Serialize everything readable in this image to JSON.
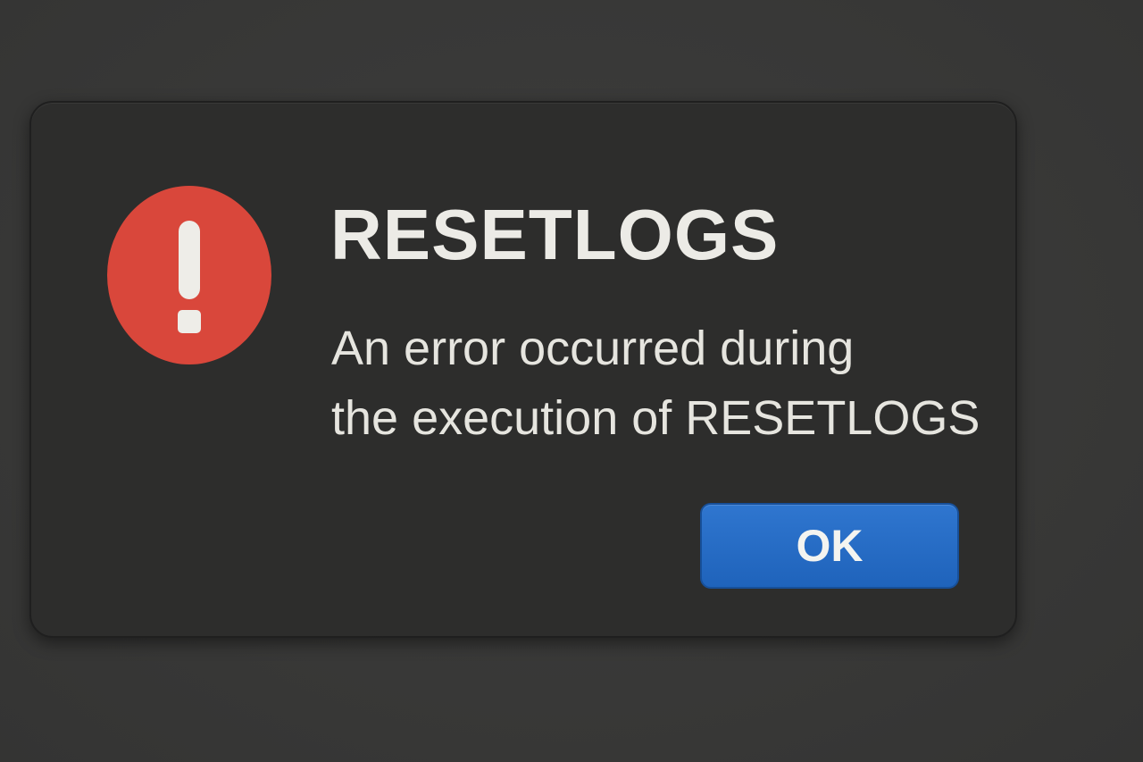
{
  "dialog": {
    "title": "RESETLOGS",
    "message_lines": [
      "An error occurred during",
      "the execution of RESETLOGS"
    ],
    "icon": "exclamation-alert-icon",
    "ok_label": "OK"
  },
  "colors": {
    "background": "#3a3a39",
    "dialog": "#2d2d2c",
    "alert_red": "#d9473b",
    "button_blue": "#2669c4",
    "text": "#ecebe6"
  }
}
